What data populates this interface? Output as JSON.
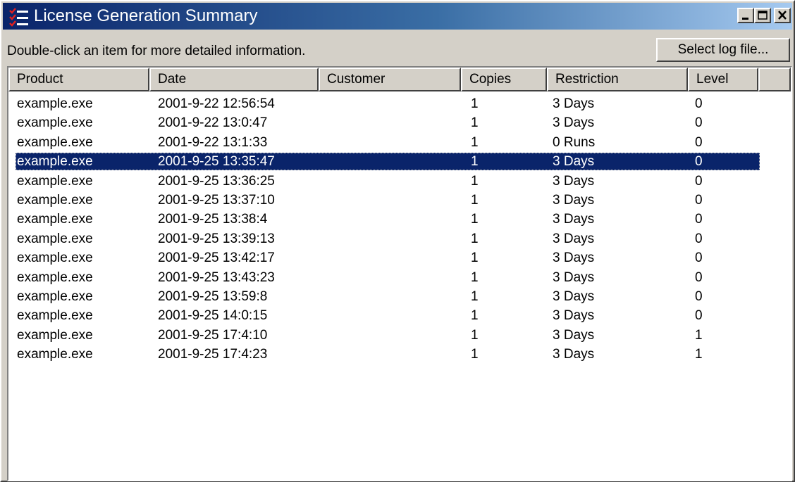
{
  "window": {
    "title": "License Generation Summary",
    "icon": "app-checklist-icon",
    "controls": [
      "minimize-icon",
      "maximize-icon",
      "close-icon"
    ]
  },
  "toolbar": {
    "hint": "Double-click an item for more detailed information.",
    "select_log_label": "Select log file..."
  },
  "colors": {
    "selection": "#0a246a",
    "title_start": "#0a246a",
    "title_end": "#a6caf0",
    "face": "#d4d0c8"
  },
  "columns": [
    "Product",
    "Date",
    "Customer",
    "Copies",
    "Restriction",
    "Level"
  ],
  "rows": [
    {
      "product": "example.exe",
      "date": "2001-9-22 12:56:54",
      "customer": "",
      "copies": "1",
      "restriction": "3 Days",
      "level": "0",
      "selected": false
    },
    {
      "product": "example.exe",
      "date": "2001-9-22 13:0:47",
      "customer": "",
      "copies": "1",
      "restriction": "3 Days",
      "level": "0",
      "selected": false
    },
    {
      "product": "example.exe",
      "date": "2001-9-22 13:1:33",
      "customer": "",
      "copies": "1",
      "restriction": "0 Runs",
      "level": "0",
      "selected": false
    },
    {
      "product": "example.exe",
      "date": "2001-9-25 13:35:47",
      "customer": "",
      "copies": "1",
      "restriction": "3 Days",
      "level": "0",
      "selected": true
    },
    {
      "product": "example.exe",
      "date": "2001-9-25 13:36:25",
      "customer": "",
      "copies": "1",
      "restriction": "3 Days",
      "level": "0",
      "selected": false
    },
    {
      "product": "example.exe",
      "date": "2001-9-25 13:37:10",
      "customer": "",
      "copies": "1",
      "restriction": "3 Days",
      "level": "0",
      "selected": false
    },
    {
      "product": "example.exe",
      "date": "2001-9-25 13:38:4",
      "customer": "",
      "copies": "1",
      "restriction": "3 Days",
      "level": "0",
      "selected": false
    },
    {
      "product": "example.exe",
      "date": "2001-9-25 13:39:13",
      "customer": "",
      "copies": "1",
      "restriction": "3 Days",
      "level": "0",
      "selected": false
    },
    {
      "product": "example.exe",
      "date": "2001-9-25 13:42:17",
      "customer": "",
      "copies": "1",
      "restriction": "3 Days",
      "level": "0",
      "selected": false
    },
    {
      "product": "example.exe",
      "date": "2001-9-25 13:43:23",
      "customer": "",
      "copies": "1",
      "restriction": "3 Days",
      "level": "0",
      "selected": false
    },
    {
      "product": "example.exe",
      "date": "2001-9-25 13:59:8",
      "customer": "",
      "copies": "1",
      "restriction": "3 Days",
      "level": "0",
      "selected": false
    },
    {
      "product": "example.exe",
      "date": "2001-9-25 14:0:15",
      "customer": "",
      "copies": "1",
      "restriction": "3 Days",
      "level": "0",
      "selected": false
    },
    {
      "product": "example.exe",
      "date": "2001-9-25 17:4:10",
      "customer": "",
      "copies": "1",
      "restriction": "3 Days",
      "level": "1",
      "selected": false
    },
    {
      "product": "example.exe",
      "date": "2001-9-25 17:4:23",
      "customer": "",
      "copies": "1",
      "restriction": "3 Days",
      "level": "1",
      "selected": false
    }
  ]
}
